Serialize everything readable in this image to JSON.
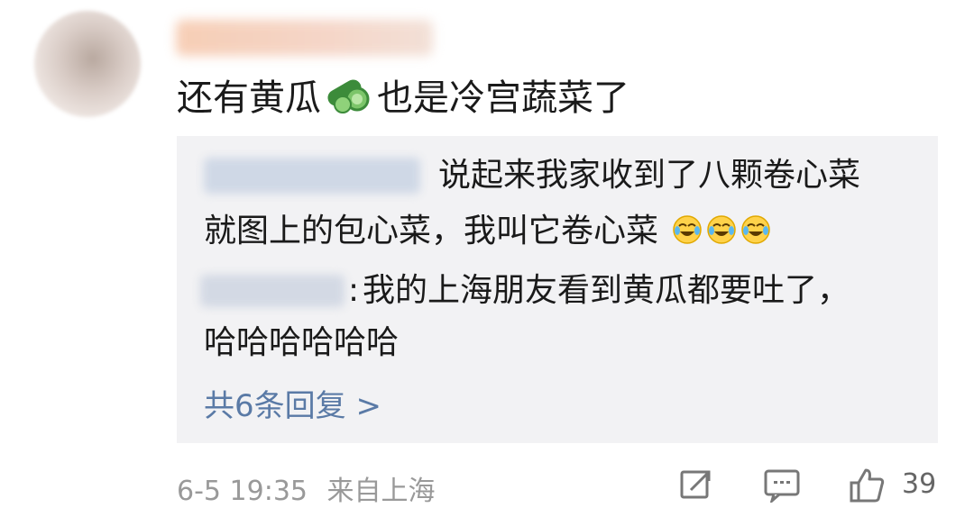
{
  "comment": {
    "text_before": "还有黄瓜",
    "emoji_name": "cucumber-emoji",
    "text_after": "也是冷宫蔬菜了"
  },
  "replies": [
    {
      "line1": "说起来我家收到了八颗卷心菜",
      "line2": "就图上的包心菜，我叫它卷心菜",
      "emoji": "laugh-cry-emoji"
    },
    {
      "separator": ":",
      "line1": "我的上海朋友看到黄瓜都要吐了，",
      "line2": "哈哈哈哈哈哈"
    }
  ],
  "more_replies": "共6条回复 >",
  "footer": {
    "date": "6-5 19:35",
    "source": "来自上海",
    "like_count": "39"
  },
  "colors": {
    "link": "#5a7aa6",
    "meta": "#999999",
    "reply_bg": "#f2f2f4"
  }
}
